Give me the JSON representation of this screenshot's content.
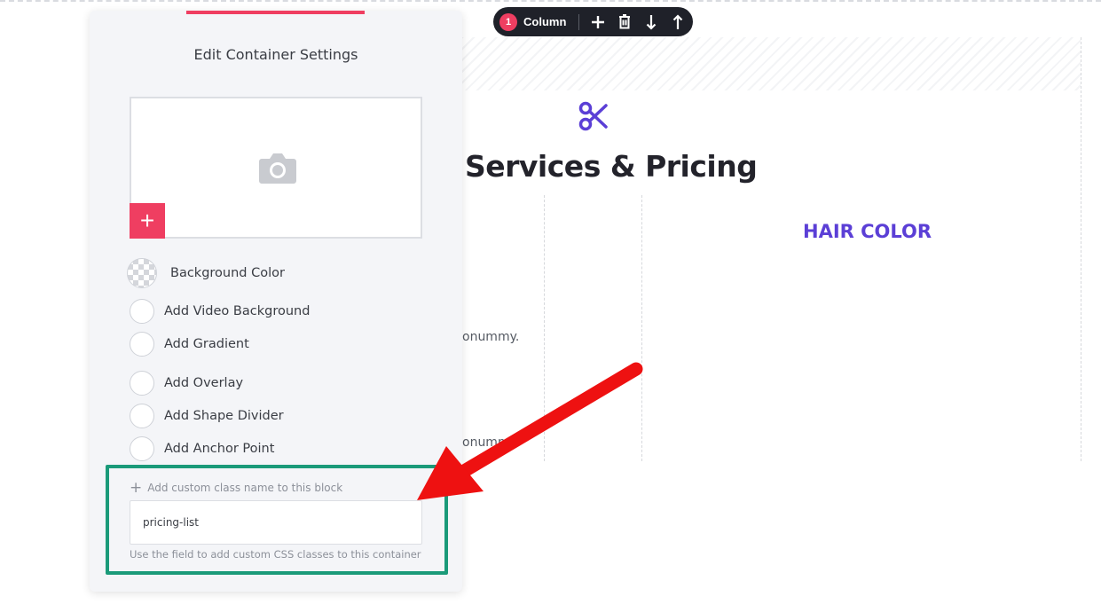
{
  "toolbar": {
    "badge_number": "1",
    "label": "Column",
    "icons": [
      "plus-icon",
      "trash-icon",
      "arrow-down-icon",
      "arrow-up-icon"
    ]
  },
  "page": {
    "heading": "Services & Pricing",
    "subheading": "HAIR COLOR",
    "desc_line_1": "onummy.",
    "desc_line_2": "onummy.",
    "icon": "scissors-icon",
    "accent_color": "#5b3fd6"
  },
  "panel": {
    "title": "Edit Container Settings",
    "background_color_label": "Background Color",
    "options": [
      {
        "label": "Add Video Background"
      },
      {
        "label": "Add Gradient"
      },
      {
        "label": "Add Overlay"
      },
      {
        "label": "Add Shape Divider"
      },
      {
        "label": "Add Anchor Point"
      }
    ],
    "add_class_label": "Add custom class name to this block",
    "class_value": "pricing-list",
    "class_hint": "Use the field to add custom CSS classes to this container",
    "accent_color": "#ef3e61",
    "highlight_color": "#1a9a79"
  },
  "annotation": {
    "arrow_color": "#ee1111"
  }
}
